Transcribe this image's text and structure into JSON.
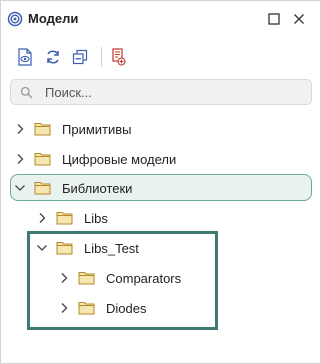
{
  "panel": {
    "title": "Модели",
    "app_icon": "spiral-icon",
    "window_buttons": [
      "maximize-icon",
      "close-icon"
    ]
  },
  "toolbar": {
    "buttons": [
      "open-model-icon",
      "refresh-icon",
      "collapse-all-icon",
      "add-library-icon"
    ]
  },
  "search": {
    "placeholder": "Поиск..."
  },
  "tree": {
    "items": [
      {
        "label": "Примитивы",
        "expanded": false,
        "level": 0
      },
      {
        "label": "Цифровые модели",
        "expanded": false,
        "level": 0
      },
      {
        "label": "Библиотеки",
        "expanded": true,
        "level": 0,
        "selected": true
      },
      {
        "label": "Libs",
        "expanded": false,
        "level": 1
      },
      {
        "label": "Libs_Test",
        "expanded": true,
        "level": 1
      },
      {
        "label": "Comparators",
        "expanded": false,
        "level": 2
      },
      {
        "label": "Diodes",
        "expanded": false,
        "level": 2
      }
    ]
  },
  "colors": {
    "accent": "#3e7a72",
    "selection_bg": "#e8f2ee",
    "selection_border": "#6aa898",
    "folder_fill": "#f6e7b0",
    "folder_stroke": "#b58a2a",
    "icon_blue": "#3a5fb0",
    "icon_red": "#c0392b"
  }
}
